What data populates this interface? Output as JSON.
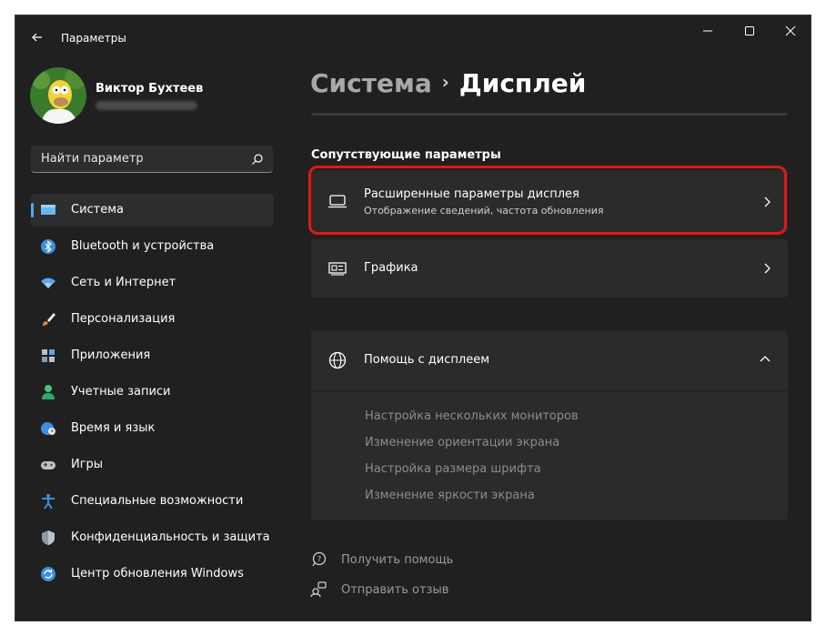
{
  "window": {
    "title": "Параметры"
  },
  "profile": {
    "name": "Виктор Бухтеев"
  },
  "search": {
    "placeholder": "Найти параметр"
  },
  "sidebar": {
    "items": [
      {
        "label": "Система",
        "icon": "system-display-icon",
        "active": true
      },
      {
        "label": "Bluetooth и устройства",
        "icon": "bluetooth-icon"
      },
      {
        "label": "Сеть и Интернет",
        "icon": "wifi-icon"
      },
      {
        "label": "Персонализация",
        "icon": "brush-icon"
      },
      {
        "label": "Приложения",
        "icon": "apps-icon"
      },
      {
        "label": "Учетные записи",
        "icon": "person-icon"
      },
      {
        "label": "Время и язык",
        "icon": "globe-clock-icon"
      },
      {
        "label": "Игры",
        "icon": "gamepad-icon"
      },
      {
        "label": "Специальные возможности",
        "icon": "accessibility-icon"
      },
      {
        "label": "Конфиденциальность и защита",
        "icon": "shield-icon"
      },
      {
        "label": "Центр обновления Windows",
        "icon": "update-icon"
      }
    ]
  },
  "breadcrumb": {
    "parent": "Система",
    "separator": "›",
    "current": "Дисплей"
  },
  "related": {
    "section_title": "Сопутствующие параметры",
    "advanced": {
      "title": "Расширенные параметры дисплея",
      "subtitle": "Отображение сведений, частота обновления"
    },
    "graphics": {
      "title": "Графика"
    }
  },
  "help": {
    "title": "Помощь с дисплеем",
    "links": [
      "Настройка нескольких мониторов",
      "Изменение ориентации экрана",
      "Настройка размера шрифта",
      "Изменение яркости экрана"
    ]
  },
  "footer": {
    "get_help": "Получить помощь",
    "feedback": "Отправить отзыв"
  },
  "colors": {
    "accent": "#5aa6e8",
    "highlight": "#e11717",
    "background": "#202020",
    "card": "#2b2b2b"
  }
}
